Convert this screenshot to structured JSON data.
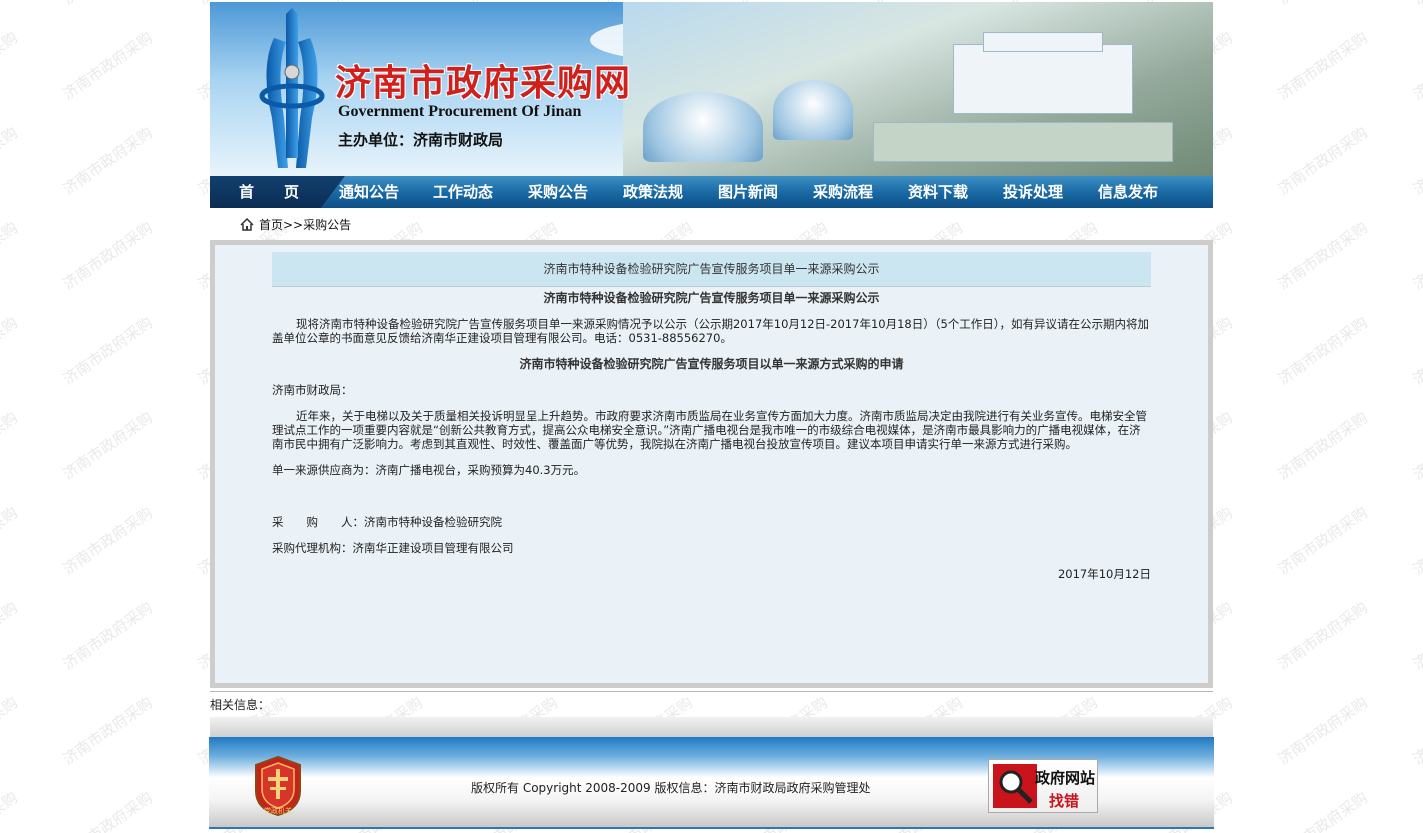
{
  "site": {
    "title_cn": "济南市政府采购网",
    "title_en": "Government Procurement Of Jinan",
    "host": "主办单位：济南市财政局"
  },
  "watermark_text": "济南市政府采购",
  "nav": {
    "items": [
      "首　　页",
      "通知公告",
      "工作动态",
      "采购公告",
      "政策法规",
      "图片新闻",
      "采购流程",
      "资料下载",
      "投诉处理",
      "信息发布"
    ]
  },
  "breadcrumb": {
    "text": "首页>>采购公告"
  },
  "notice": {
    "header_title": "济南市特种设备检验研究院广告宣传服务项目单一来源采购公示",
    "heading": "济南市特种设备检验研究院广告宣传服务项目单一来源采购公示",
    "intro": "现将济南市特种设备检验研究院广告宣传服务项目单一来源采购情况予以公示（公示期2017年10月12日-2017年10月18日）（5个工作日），如有异议请在公示期内将加盖单位公章的书面意见反馈给济南华正建设项目管理有限公司。电话：0531-88556270。",
    "sub_heading": "济南市特种设备检验研究院广告宣传服务项目以单一来源方式采购的申请",
    "salutation": "济南市财政局：",
    "body": "近年来，关于电梯以及关于质量相关投诉明显呈上升趋势。市政府要求济南市质监局在业务宣传方面加大力度。济南市质监局决定由我院进行有关业务宣传。电梯安全管理试点工作的一项重要内容就是“创新公共教育方式，提高公众电梯安全意识。”济南广播电视台是我市唯一的市级综合电视媒体，是济南市最具影响力的广播电视媒体，在济南市民中拥有广泛影响力。考虑到其直观性、时效性、覆盖面广等优势，我院拟在济南广播电视台投放宣传项目。建议本项目申请实行单一来源方式进行采购。",
    "supplier": "单一来源供应商为：济南广播电视台，采购预算为40.3万元。",
    "purchaser": "采　　购　　人：济南市特种设备检验研究院",
    "agency": "采购代理机构：济南华正建设项目管理有限公司",
    "date": "2017年10月12日"
  },
  "related": {
    "label": "相关信息："
  },
  "footer": {
    "badge_text": "党政机关",
    "copyright": "版权所有 Copyright 2008-2009 版权信息：济南市财政局政府采购管理处",
    "jiucuo_line1": "政府网站",
    "jiucuo_line2": "找错"
  },
  "colors": {
    "nav_top": "#3d8fc3",
    "nav_bottom": "#0e4f84",
    "title_red": "#d0201b",
    "content_bg": "#eaf2f7",
    "notice_head_bg": "#cbe6f0"
  }
}
